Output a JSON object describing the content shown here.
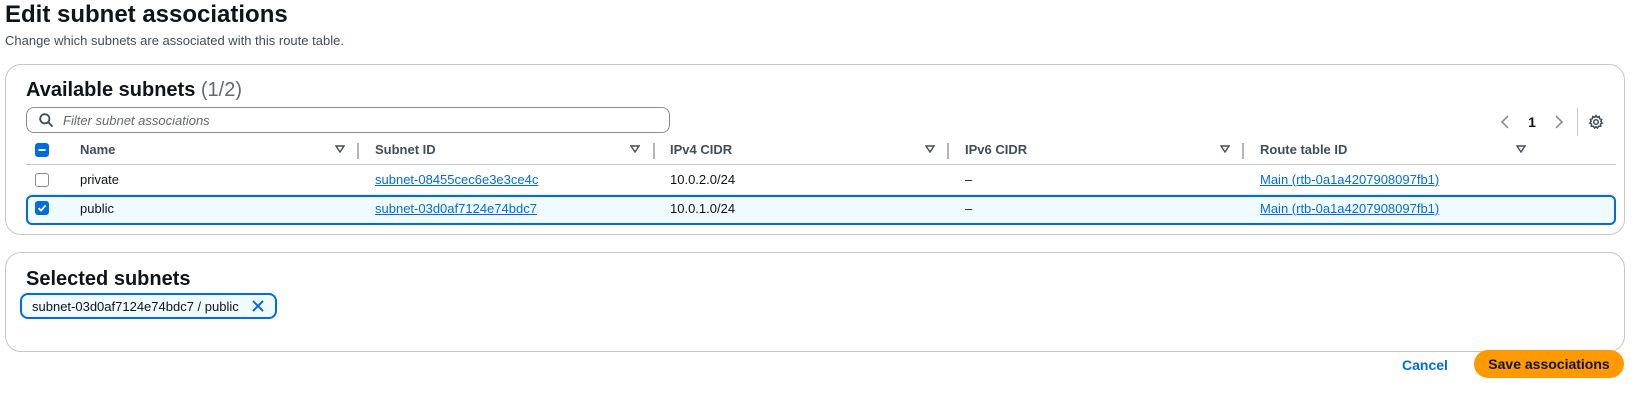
{
  "page": {
    "title": "Edit subnet associations",
    "description": "Change which subnets are associated with this route table."
  },
  "available": {
    "title": "Available subnets",
    "count": "(1/2)",
    "filter_placeholder": "Filter subnet associations",
    "filter_value": "",
    "page_number": "1",
    "columns": [
      "Name",
      "Subnet ID",
      "IPv4 CIDR",
      "IPv6 CIDR",
      "Route table ID"
    ],
    "rows": [
      {
        "name": "private",
        "subnet_id": "subnet-08455cec6e3e3ce4c",
        "ipv4": "10.0.2.0/24",
        "ipv6": "–",
        "route_table": "Main (rtb-0a1a4207908097fb1)",
        "checked": false
      },
      {
        "name": "public",
        "subnet_id": "subnet-03d0af7124e74bdc7",
        "ipv4": "10.0.1.0/24",
        "ipv6": "–",
        "route_table": "Main (rtb-0a1a4207908097fb1)",
        "checked": true
      }
    ]
  },
  "selected": {
    "title": "Selected subnets",
    "tokens": [
      "subnet-03d0af7124e74bdc7 / public"
    ]
  },
  "actions": {
    "cancel": "Cancel",
    "save": "Save associations"
  },
  "colors": {
    "accent": "#006ce0",
    "primary_button": "#ff9900",
    "selected_row_bg": "#f0fbff"
  },
  "icons": [
    "search-icon",
    "chevron-left-icon",
    "chevron-right-icon",
    "settings-gear-icon",
    "sort-caret-icon",
    "checkmark-icon",
    "indeterminate-icon",
    "close-icon"
  ]
}
